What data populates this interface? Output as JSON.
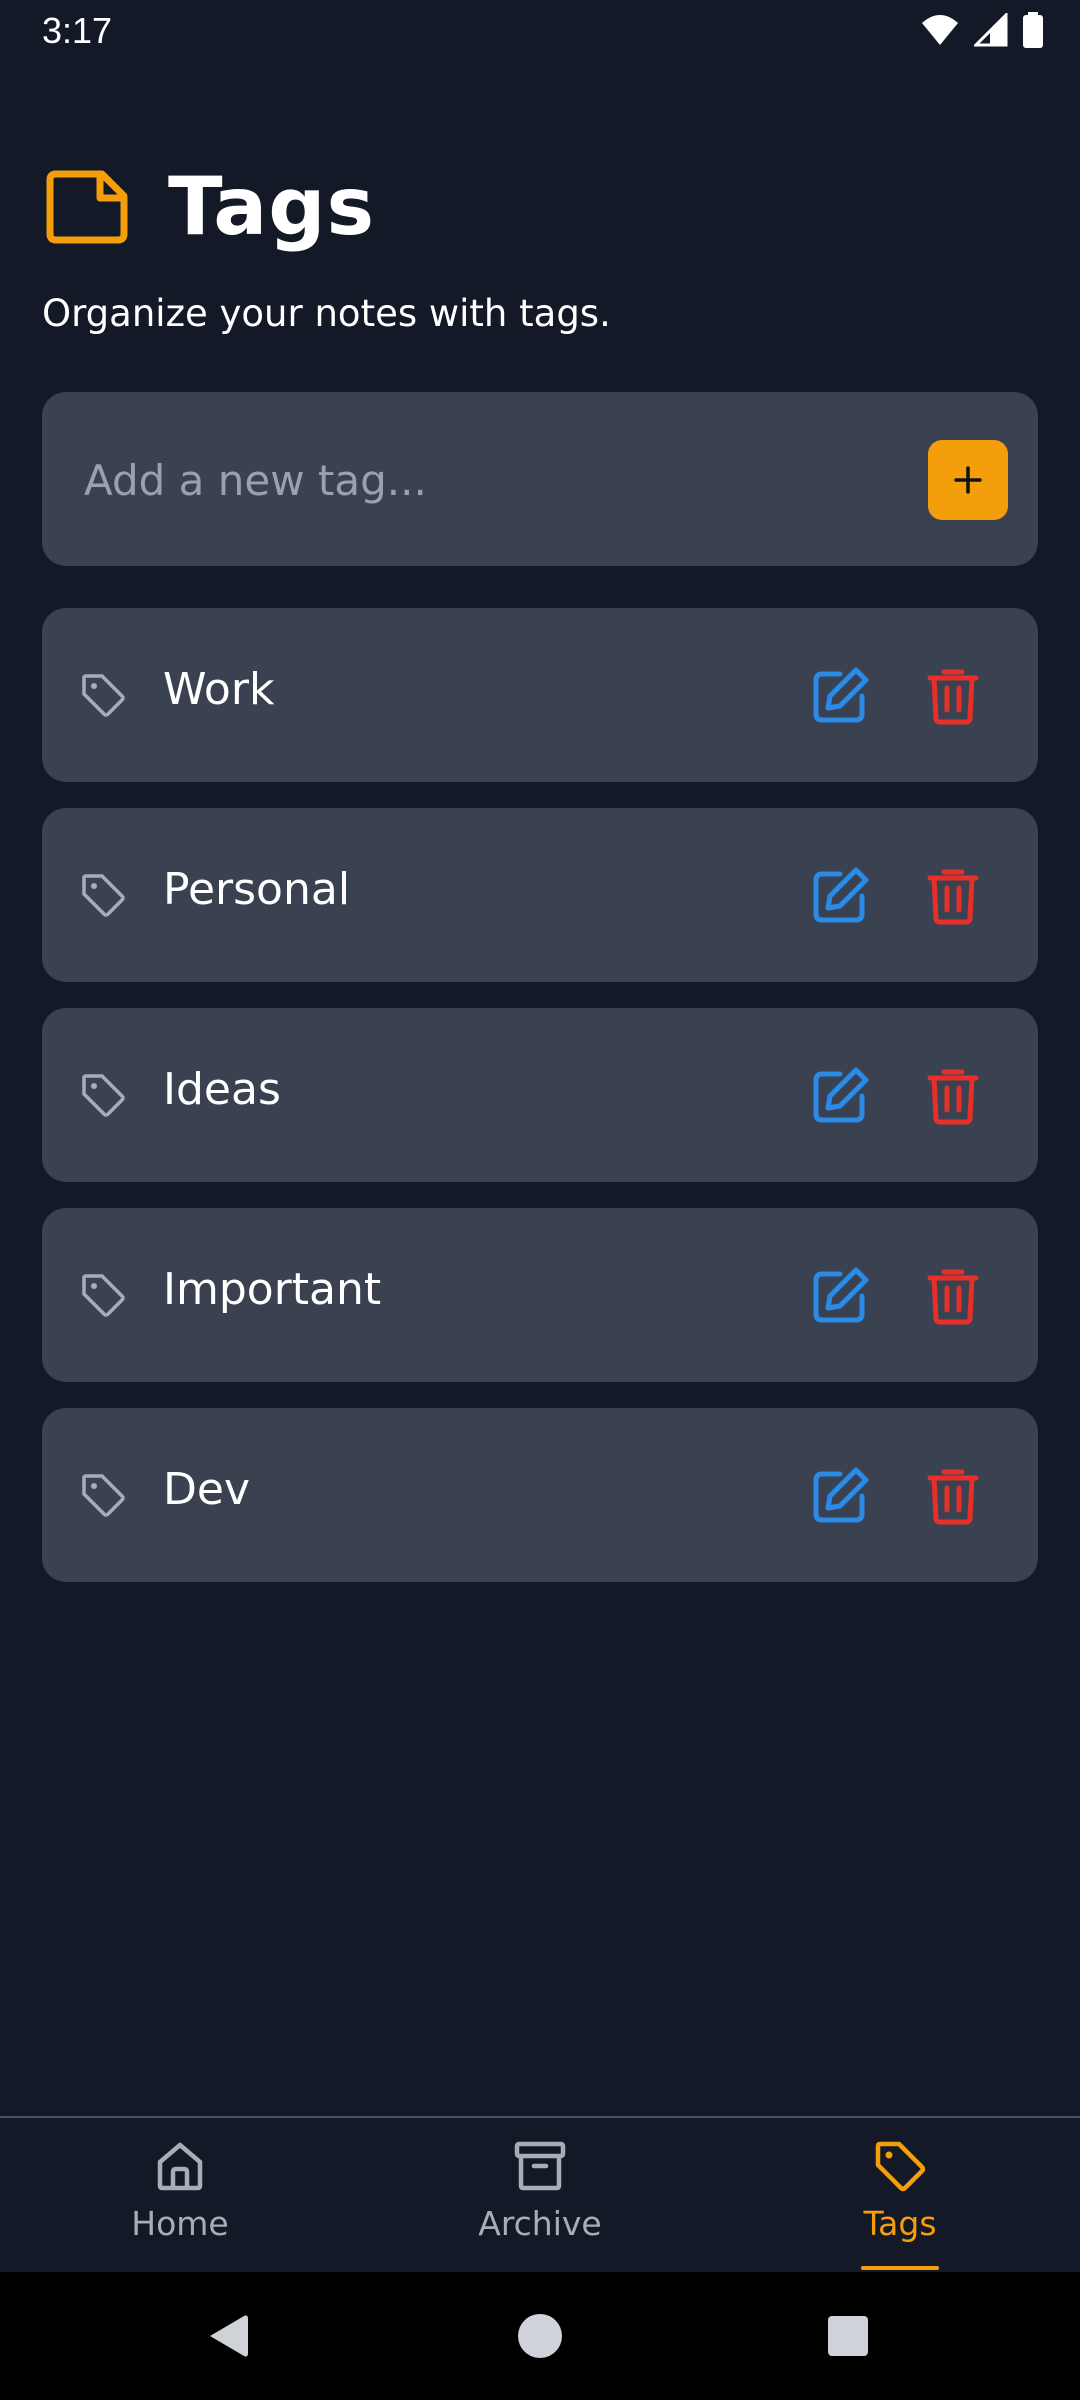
{
  "status_bar": {
    "time": "3:17",
    "icons": [
      "wifi-icon",
      "signal-icon",
      "battery-icon"
    ]
  },
  "header": {
    "icon": "note-icon",
    "title": "Tags",
    "subtitle": "Organize your notes with tags."
  },
  "add_tag": {
    "placeholder": "Add a new tag...",
    "value": "",
    "button_icon": "plus-icon"
  },
  "tags": [
    {
      "label": "Work"
    },
    {
      "label": "Personal"
    },
    {
      "label": "Ideas"
    },
    {
      "label": "Important"
    },
    {
      "label": "Dev"
    }
  ],
  "bottom_nav": {
    "items": [
      {
        "label": "Home",
        "icon": "home-icon",
        "active": false
      },
      {
        "label": "Archive",
        "icon": "archive-icon",
        "active": false
      },
      {
        "label": "Tags",
        "icon": "tag-icon",
        "active": true
      }
    ]
  },
  "system_nav": [
    "back-icon",
    "home-circle-icon",
    "recents-icon"
  ],
  "colors": {
    "background": "#141927",
    "card": "#3a4252",
    "accent": "#f59e0b",
    "edit": "#2b8ae6",
    "delete": "#e5302a",
    "muted": "#a8adb7"
  }
}
